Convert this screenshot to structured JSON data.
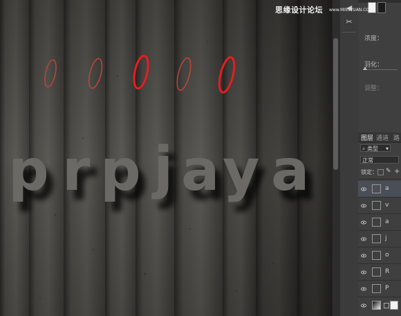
{
  "watermark": {
    "site_cn": "思缘设计论坛",
    "site_url": "www.MISSYUAN.COM"
  },
  "canvas": {
    "text_letters": [
      "p",
      "r",
      "p",
      "j",
      "a",
      "y",
      "a"
    ]
  },
  "properties_panel": {
    "density_label": "浓度：",
    "feather_label": "羽化：",
    "adjust_label": "调整："
  },
  "layers_panel": {
    "tabs": [
      "图层",
      "通道",
      "路"
    ],
    "filter_kind_label": "类型",
    "blend_mode": "正常",
    "lock_label": "锁定：",
    "layers": [
      {
        "name": "a",
        "selected": true
      },
      {
        "name": "v",
        "selected": false
      },
      {
        "name": "a",
        "selected": false
      },
      {
        "name": "j",
        "selected": false
      },
      {
        "name": "o",
        "selected": false
      },
      {
        "name": "R",
        "selected": false
      },
      {
        "name": "P",
        "selected": false
      },
      {
        "name": "",
        "selected": false
      }
    ]
  }
}
